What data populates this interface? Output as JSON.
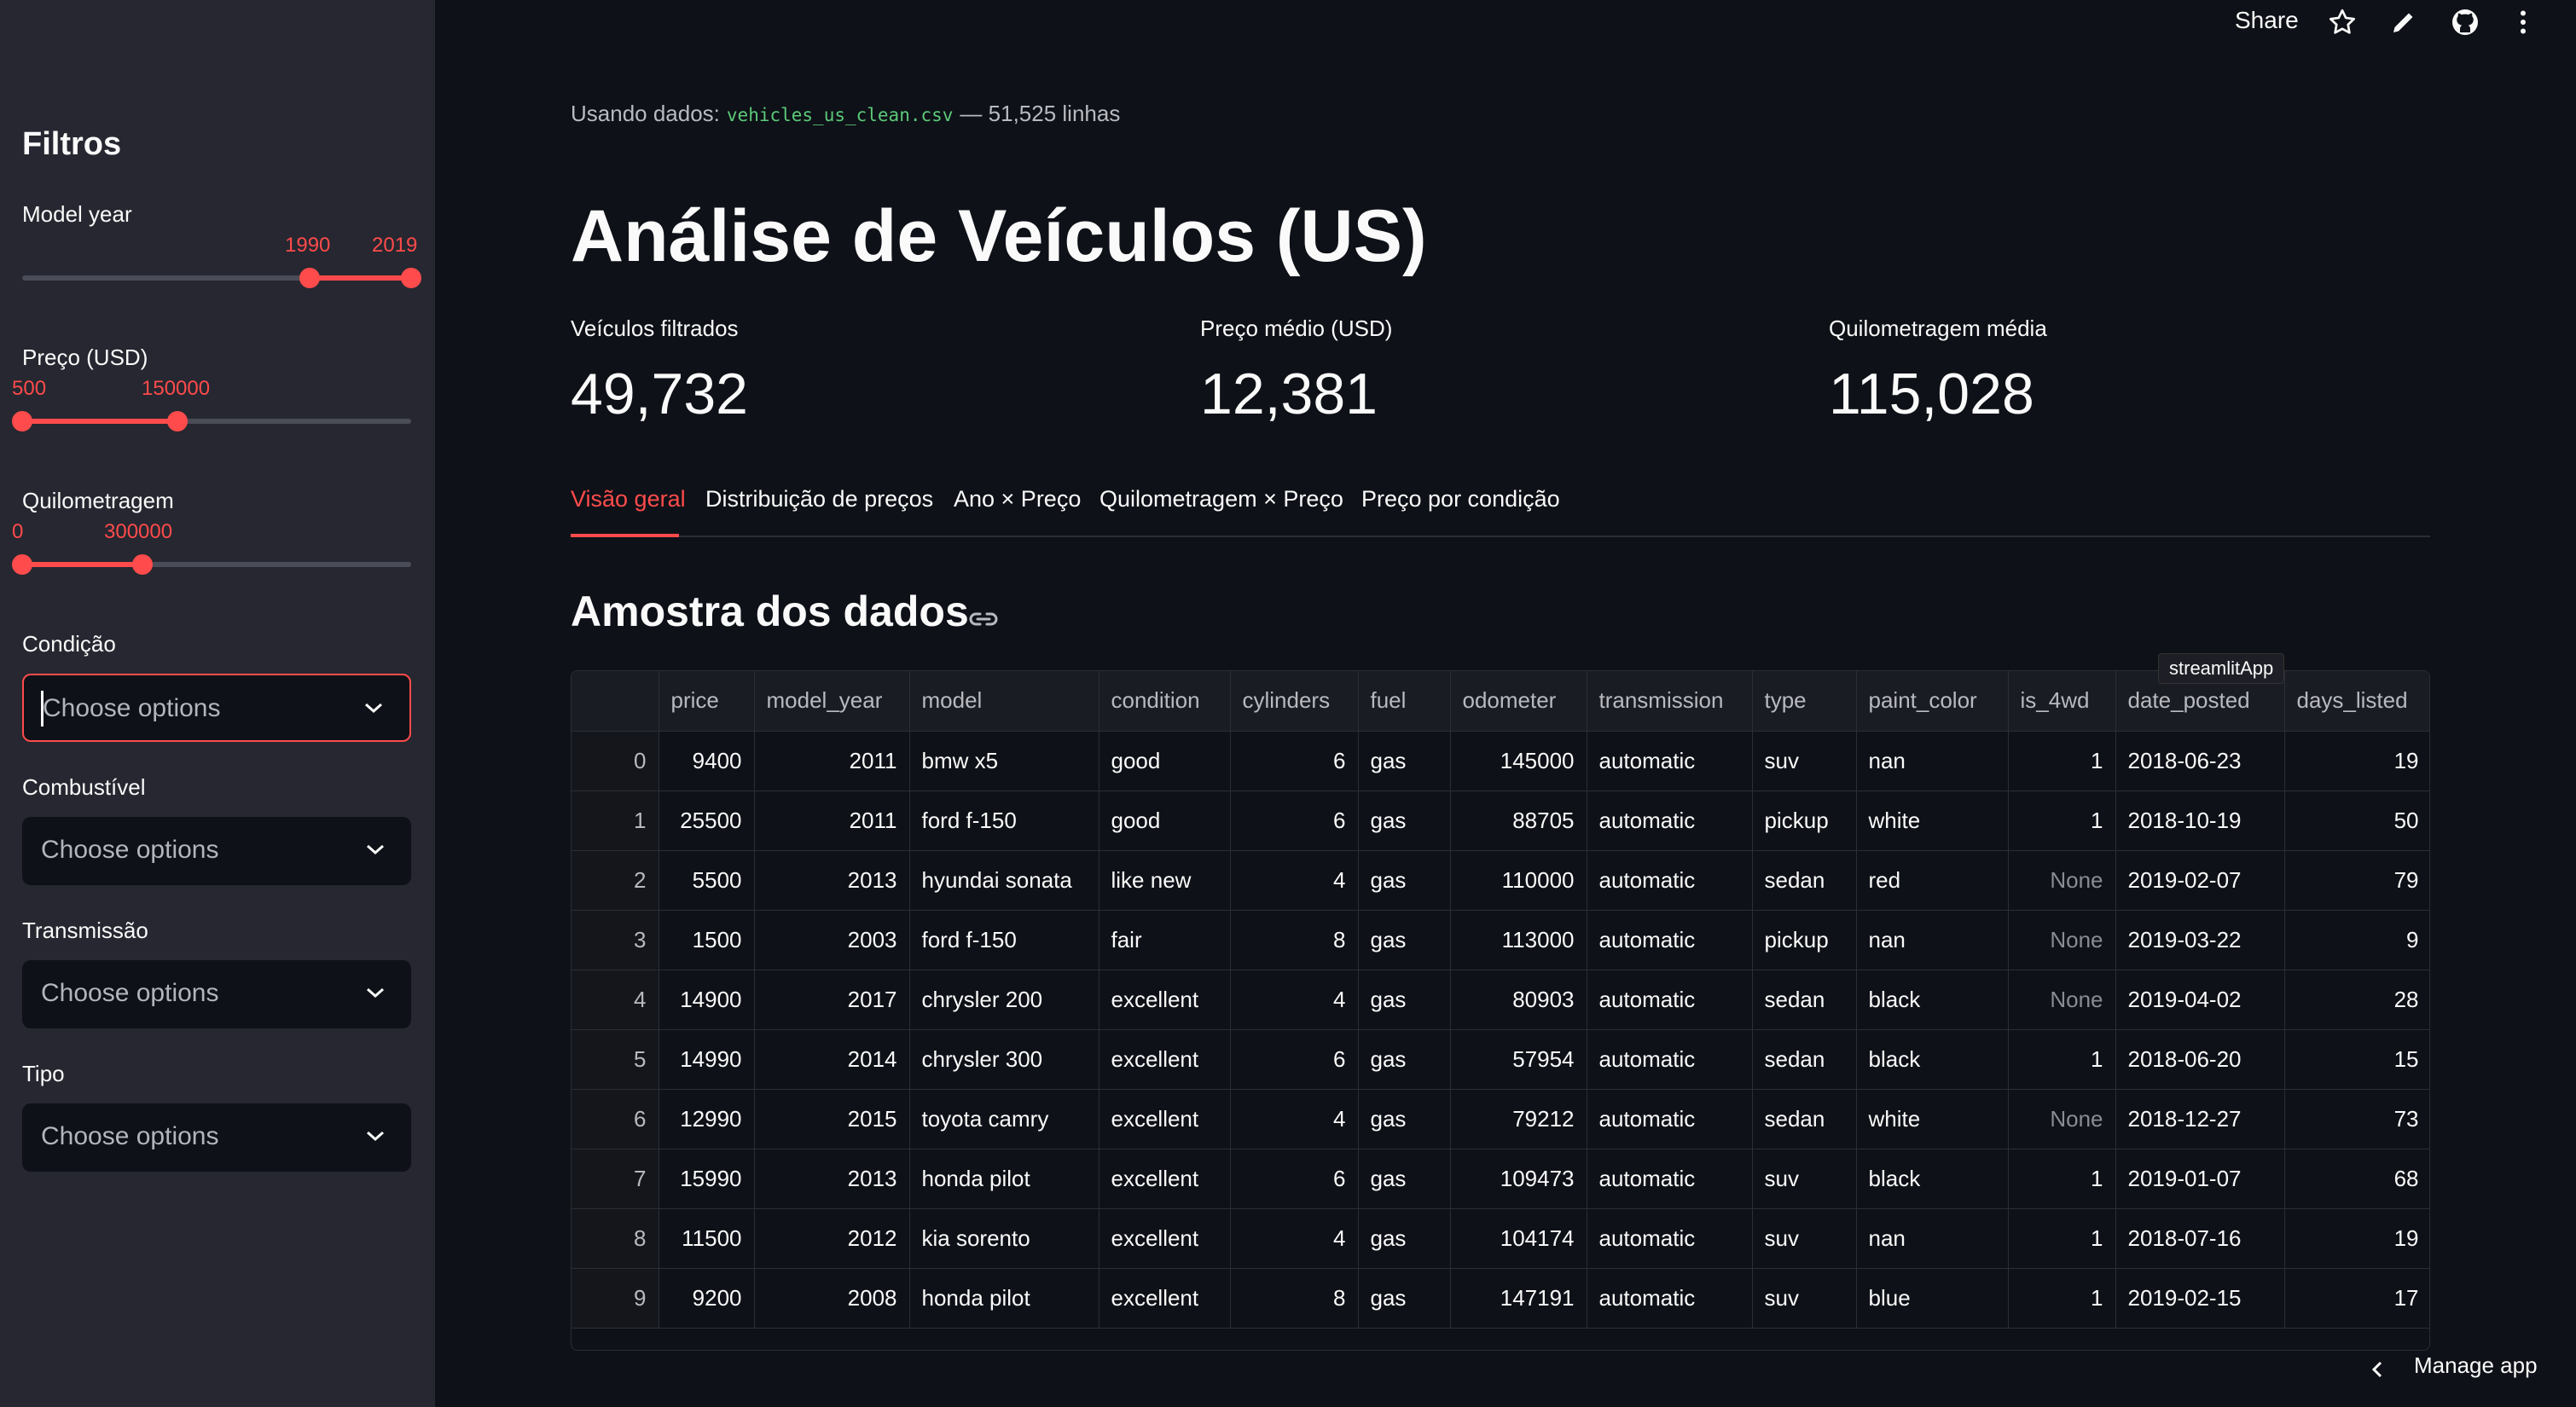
{
  "header": {
    "share_label": "Share",
    "icons": [
      "star-icon",
      "pencil-icon",
      "github-icon",
      "kebab-menu-icon"
    ]
  },
  "sidebar": {
    "title": "Filtros",
    "model_year": {
      "label": "Model year",
      "min_val": "1990",
      "max_val": "2019",
      "low_fraction": 0.74,
      "high_fraction": 1.0
    },
    "price": {
      "label": "Preço (USD)",
      "min_val": "500",
      "max_val": "150000",
      "low_fraction": 0.0,
      "high_fraction": 0.4
    },
    "mileage": {
      "label": "Quilometragem",
      "min_val": "0",
      "max_val": "300000",
      "low_fraction": 0.0,
      "high_fraction": 0.31
    },
    "condition": {
      "label": "Condição",
      "placeholder": "Choose options"
    },
    "fuel": {
      "label": "Combustível",
      "placeholder": "Choose options"
    },
    "transmission": {
      "label": "Transmissão",
      "placeholder": "Choose options"
    },
    "type": {
      "label": "Tipo",
      "placeholder": "Choose options"
    }
  },
  "main": {
    "using_prefix": "Usando dados:",
    "filename": "vehicles_us_clean.csv",
    "rows_text": "— 51,525 linhas",
    "title": "Análise de Veículos (US)",
    "metrics": [
      {
        "label": "Veículos filtrados",
        "value": "49,732"
      },
      {
        "label": "Preço médio (USD)",
        "value": "12,381"
      },
      {
        "label": "Quilometragem média",
        "value": "115,028"
      }
    ],
    "tabs": [
      "Visão geral",
      "Distribuição de preços",
      "Ano × Preço",
      "Quilometragem × Preço",
      "Preço por condição"
    ],
    "section_title": "Amostra dos dados",
    "tooltip": "streamlitApp"
  },
  "table": {
    "columns": [
      "",
      "price",
      "model_year",
      "model",
      "condition",
      "cylinders",
      "fuel",
      "odometer",
      "transmission",
      "type",
      "paint_color",
      "is_4wd",
      "date_posted",
      "days_listed"
    ],
    "rows": [
      [
        "0",
        "9400",
        "2011",
        "bmw x5",
        "good",
        "6",
        "gas",
        "145000",
        "automatic",
        "suv",
        "nan",
        "1",
        "2018-06-23",
        "19"
      ],
      [
        "1",
        "25500",
        "2011",
        "ford f-150",
        "good",
        "6",
        "gas",
        "88705",
        "automatic",
        "pickup",
        "white",
        "1",
        "2018-10-19",
        "50"
      ],
      [
        "2",
        "5500",
        "2013",
        "hyundai sonata",
        "like new",
        "4",
        "gas",
        "110000",
        "automatic",
        "sedan",
        "red",
        "None",
        "2019-02-07",
        "79"
      ],
      [
        "3",
        "1500",
        "2003",
        "ford f-150",
        "fair",
        "8",
        "gas",
        "113000",
        "automatic",
        "pickup",
        "nan",
        "None",
        "2019-03-22",
        "9"
      ],
      [
        "4",
        "14900",
        "2017",
        "chrysler 200",
        "excellent",
        "4",
        "gas",
        "80903",
        "automatic",
        "sedan",
        "black",
        "None",
        "2019-04-02",
        "28"
      ],
      [
        "5",
        "14990",
        "2014",
        "chrysler 300",
        "excellent",
        "6",
        "gas",
        "57954",
        "automatic",
        "sedan",
        "black",
        "1",
        "2018-06-20",
        "15"
      ],
      [
        "6",
        "12990",
        "2015",
        "toyota camry",
        "excellent",
        "4",
        "gas",
        "79212",
        "automatic",
        "sedan",
        "white",
        "None",
        "2018-12-27",
        "73"
      ],
      [
        "7",
        "15990",
        "2013",
        "honda pilot",
        "excellent",
        "6",
        "gas",
        "109473",
        "automatic",
        "suv",
        "black",
        "1",
        "2019-01-07",
        "68"
      ],
      [
        "8",
        "11500",
        "2012",
        "kia sorento",
        "excellent",
        "4",
        "gas",
        "104174",
        "automatic",
        "suv",
        "nan",
        "1",
        "2018-07-16",
        "19"
      ],
      [
        "9",
        "9200",
        "2008",
        "honda pilot",
        "excellent",
        "8",
        "gas",
        "147191",
        "automatic",
        "suv",
        "blue",
        "1",
        "2019-02-15",
        "17"
      ]
    ]
  },
  "footer": {
    "manage_label": "Manage app"
  },
  "colors": {
    "accent": "#ff4b4b",
    "background": "#0e1117",
    "sidebar": "#262730",
    "code": "#5cc97a"
  }
}
